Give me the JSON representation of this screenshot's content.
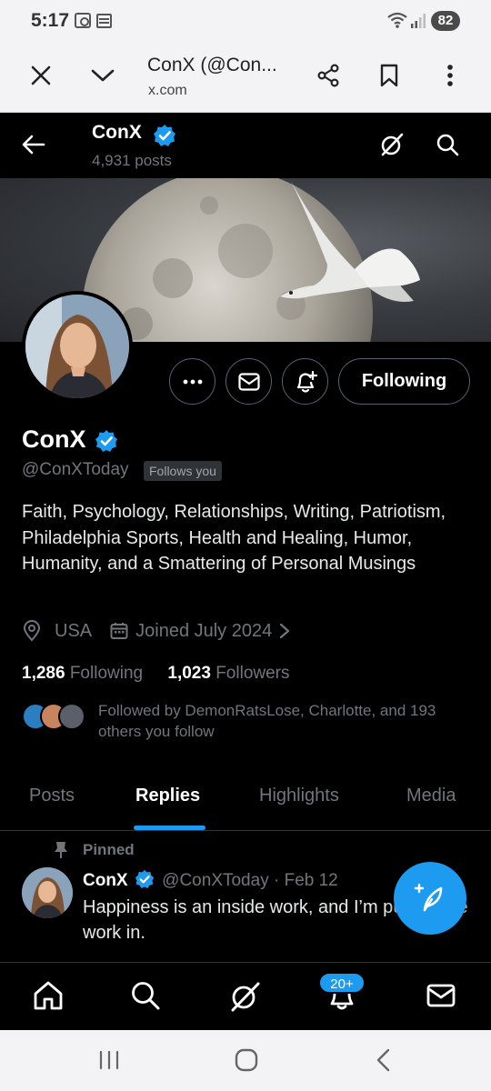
{
  "status_bar": {
    "time": "5:17",
    "battery": "82"
  },
  "browser": {
    "title": "ConX (@Con...",
    "url": "x.com"
  },
  "header": {
    "name": "ConX",
    "posts_count": "4,931 posts"
  },
  "profile": {
    "name": "ConX",
    "handle": "@ConXToday",
    "follows_you": "Follows you",
    "follow_button": "Following",
    "bio": "Faith, Psychology, Relationships, Writing, Patriotism, Philadelphia Sports, Health and Healing, Humor, Humanity, and a Smattering of Personal Musings",
    "location": "USA",
    "joined": "Joined July 2024",
    "following_count": "1,286",
    "following_label": "Following",
    "followers_count": "1,023",
    "followers_label": "Followers",
    "followed_by": "Followed by DemonRatsLose, Charlotte, and 193 others you follow"
  },
  "tabs": [
    {
      "label": "Posts"
    },
    {
      "label": "Replies"
    },
    {
      "label": "Highlights"
    },
    {
      "label": "Media"
    }
  ],
  "active_tab": "Replies",
  "pinned_post": {
    "pinned_label": "Pinned",
    "author": "ConX",
    "handle": "@ConXToday",
    "separator": "·",
    "date": "Feb 12",
    "text": "Happiness is an inside work, and I’m putting the work in."
  },
  "notifications_badge": "20+",
  "colors": {
    "accent": "#1d9bf0",
    "background": "#000000",
    "muted": "#71767b",
    "border": "#2f3336"
  },
  "icons": [
    "close-icon",
    "chevron-down-icon",
    "share-icon",
    "bookmark-icon",
    "more-vert-icon",
    "back-arrow-icon",
    "verified-badge-icon",
    "grok-icon",
    "search-icon",
    "more-horizontal-icon",
    "message-icon",
    "notify-bell-icon",
    "location-icon",
    "calendar-icon",
    "chevron-right-icon",
    "pin-icon",
    "compose-feather-icon",
    "home-icon",
    "bell-icon",
    "mail-icon"
  ]
}
